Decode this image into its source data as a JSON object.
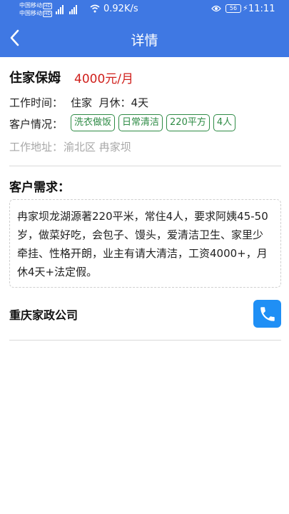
{
  "status_bar": {
    "carrier1": "中国移动",
    "carrier2": "中国移动",
    "hd": "HD",
    "network": "4G",
    "speed": "0.92K/s",
    "battery": "56",
    "time": "11:11"
  },
  "header": {
    "title": "详情",
    "back_icon": "chevron-left-icon",
    "background": "#3f78e3"
  },
  "job": {
    "type": "住家保姆",
    "salary": "4000元/月",
    "salary_color": "#d0201c",
    "work_time_label": "工作时间：",
    "work_time_value": "住家  月休：4天",
    "customer_label": "客户情况：",
    "tags": [
      "洗衣做饭",
      "日常清洁",
      "220平方",
      "4人"
    ],
    "tag_color": "#2e8b45",
    "address_label": "工作地址：",
    "address_value": "渝北区 冉家坝"
  },
  "requirements": {
    "title": "客户需求：",
    "text": "冉家坝龙湖源著220平米，常住4人，要求阿姨45-50岁，做菜好吃，会包子、馒头，爱清洁卫生、家里少牵挂、性格开朗，业主有请大清洁，工资4000+，月休4天+法定假。"
  },
  "company": {
    "name": "重庆家政公司",
    "phone_icon": "phone-icon"
  }
}
